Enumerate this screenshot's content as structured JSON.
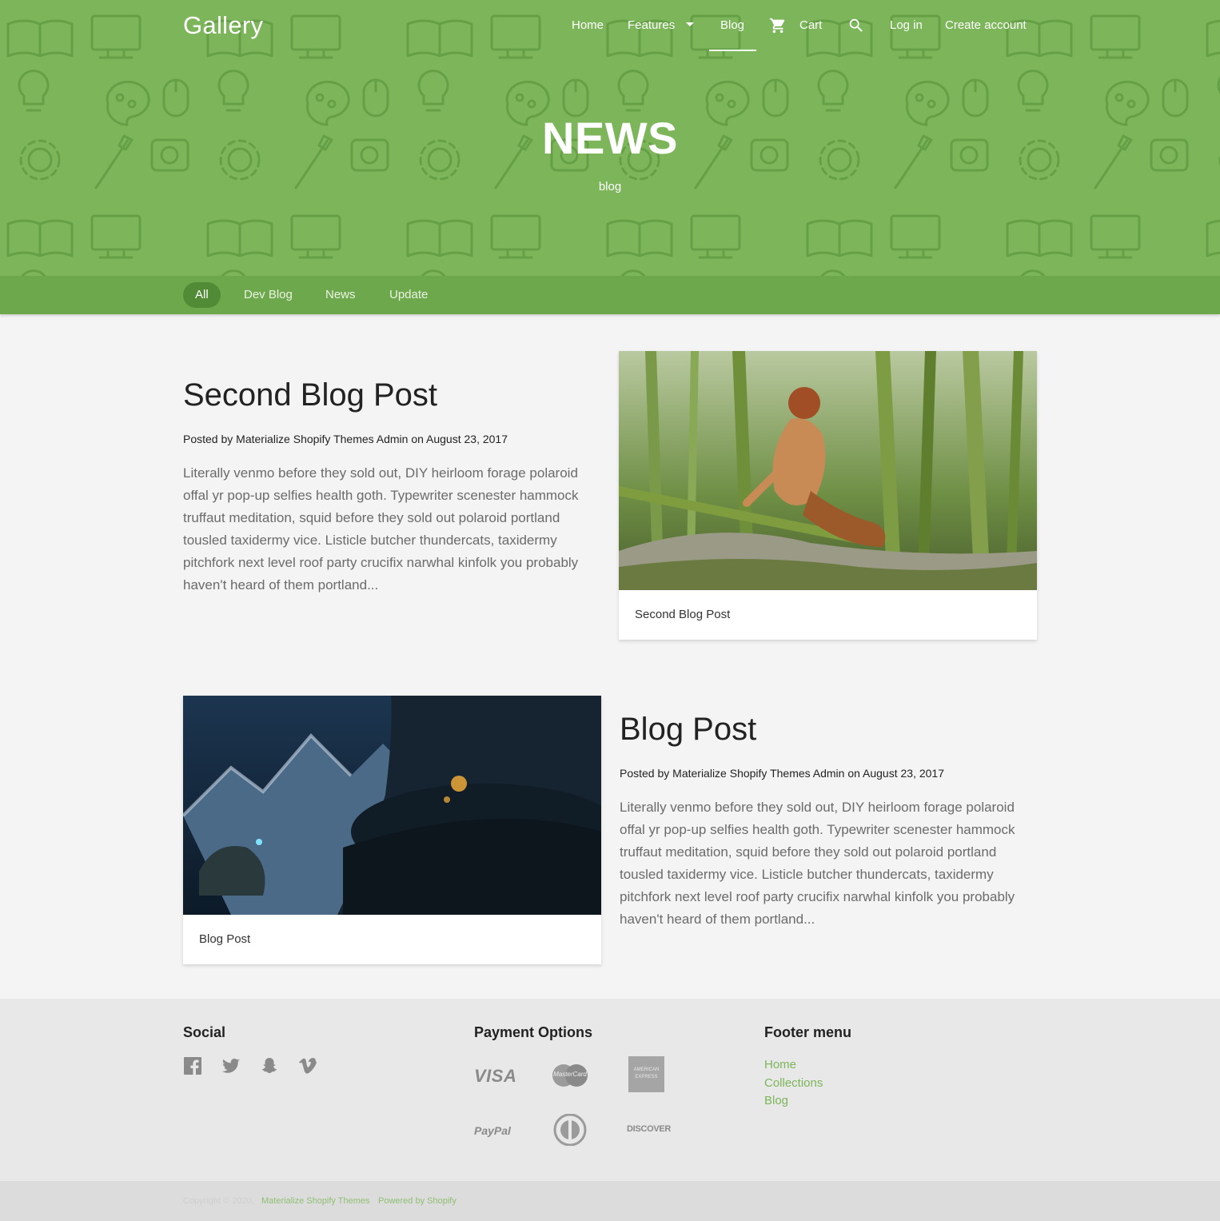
{
  "header": {
    "brand": "Gallery",
    "nav": {
      "home": "Home",
      "features": "Features",
      "blog": "Blog",
      "cart": "Cart",
      "login": "Log in",
      "create_account": "Create account"
    },
    "icons": {
      "cart": "cart-icon",
      "search": "search-icon",
      "caret": "caret-down-icon"
    },
    "hero_title": "NEWS",
    "hero_subtitle": "blog"
  },
  "tabs": [
    {
      "label": "All",
      "active": true
    },
    {
      "label": "Dev Blog",
      "active": false
    },
    {
      "label": "News",
      "active": false
    },
    {
      "label": "Update",
      "active": false
    }
  ],
  "posts": [
    {
      "title": "Second Blog Post",
      "meta": "Posted by Materialize Shopify Themes Admin on August 23, 2017",
      "excerpt": "Literally venmo before they sold out, DIY heirloom forage polaroid offal yr pop-up selfies health goth. Typewriter scenester hammock truffaut meditation, squid before they sold out polaroid portland tousled taxidermy vice. Listicle butcher thundercats, taxidermy pitchfork next level roof party crucifix narwhal kinfolk you probably haven't heard of them portland...",
      "card_caption": "Second Blog Post"
    },
    {
      "title": "Blog Post",
      "meta": "Posted by Materialize Shopify Themes Admin on August 23, 2017",
      "excerpt": "Literally venmo before they sold out, DIY heirloom forage polaroid offal yr pop-up selfies health goth. Typewriter scenester hammock truffaut meditation, squid before they sold out polaroid portland tousled taxidermy vice. Listicle butcher thundercats, taxidermy pitchfork next level roof party crucifix narwhal kinfolk you probably haven't heard of them portland...",
      "card_caption": "Blog Post"
    }
  ],
  "footer": {
    "social_heading": "Social",
    "social_icons": [
      "facebook-icon",
      "twitter-icon",
      "snapchat-icon",
      "vimeo-icon"
    ],
    "payment_heading": "Payment Options",
    "payments": {
      "visa": "VISA",
      "mastercard": "MasterCard",
      "amex_line1": "AMERICAN",
      "amex_line2": "EXPRESS",
      "paypal": "PayPal",
      "discover": "DISCOVER"
    },
    "menu_heading": "Footer menu",
    "menu_links": [
      "Home",
      "Collections",
      "Blog"
    ]
  },
  "copyright": {
    "text": "Copyright © 2020,",
    "theme_link": "Materialize Shopify Themes",
    "powered": "Powered by Shopify"
  },
  "colors": {
    "brand_green": "#7cb55a",
    "tabbar_green": "#6ea84c",
    "tab_active": "#528b35",
    "link_green": "#7cb55a"
  }
}
